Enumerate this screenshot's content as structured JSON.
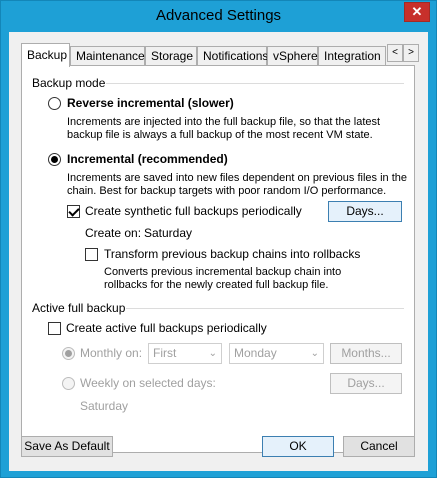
{
  "window": {
    "title": "Advanced Settings",
    "close_glyph": "✕"
  },
  "tabs": [
    {
      "label": "Backup",
      "active": true
    },
    {
      "label": "Maintenance"
    },
    {
      "label": "Storage"
    },
    {
      "label": "Notifications"
    },
    {
      "label": "vSphere"
    },
    {
      "label": "Integration"
    }
  ],
  "tab_scroll": {
    "left": "<",
    "right": ">"
  },
  "backup_mode": {
    "heading": "Backup mode",
    "reverse": {
      "label": "Reverse incremental (slower)",
      "selected": false,
      "description": "Increments are injected into the full backup file, so that the latest backup file is always a full backup of the most recent VM state."
    },
    "incremental": {
      "label": "Incremental (recommended)",
      "selected": true,
      "description": "Increments are saved into new files dependent on previous files in the chain. Best for backup targets with poor random I/O performance."
    },
    "synthetic": {
      "label": "Create synthetic full backups periodically",
      "checked": true,
      "days_button": "Days...",
      "create_on_label": "Create on:",
      "create_on_value": "Saturday"
    },
    "transform": {
      "label": "Transform previous backup chains into rollbacks",
      "checked": false,
      "description": "Converts previous incremental backup chain into rollbacks for the newly created full backup file."
    }
  },
  "active_full": {
    "heading": "Active full backup",
    "checkbox_label": "Create active full backups periodically",
    "checked": false,
    "monthly": {
      "label": "Monthly on:",
      "selected": true,
      "week_select": "First",
      "day_select": "Monday",
      "months_button": "Months..."
    },
    "weekly": {
      "label": "Weekly on selected days:",
      "selected": false,
      "days_button": "Days...",
      "days_value": "Saturday"
    }
  },
  "footer": {
    "save_default": "Save As Default",
    "ok": "OK",
    "cancel": "Cancel"
  }
}
